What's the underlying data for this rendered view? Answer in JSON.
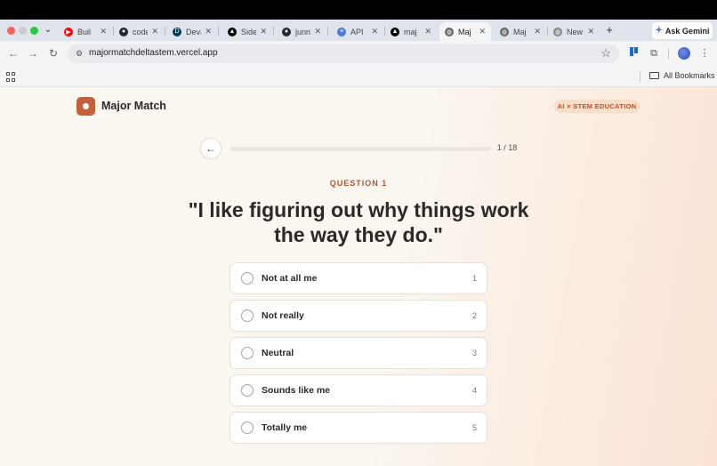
{
  "browser": {
    "tabs": [
      {
        "title": "Buil",
        "favicon": "youtube-icon",
        "color": "#ff0000",
        "glyph": "▶",
        "active": false
      },
      {
        "title": "code",
        "favicon": "github-icon",
        "color": "#24292f",
        "glyph": "●",
        "active": false
      },
      {
        "title": "Deva",
        "favicon": "devpost-icon",
        "color": "#003e54",
        "glyph": "D",
        "active": false
      },
      {
        "title": "Side",
        "favicon": "vercel-icon",
        "color": "#000000",
        "glyph": "▲",
        "active": false
      },
      {
        "title": "junn",
        "favicon": "github-icon",
        "color": "#24292f",
        "glyph": "●",
        "active": false
      },
      {
        "title": "API",
        "favicon": "api-icon",
        "color": "#4a7bd8",
        "glyph": "≡",
        "active": false
      },
      {
        "title": "maj",
        "favicon": "vercel-icon",
        "color": "#000000",
        "glyph": "▲",
        "active": false
      },
      {
        "title": "Maj",
        "favicon": "globe-icon",
        "color": "#666666",
        "glyph": "◍",
        "active": true
      },
      {
        "title": "Maj",
        "favicon": "globe-icon",
        "color": "#666666",
        "glyph": "◍",
        "active": false
      },
      {
        "title": "New",
        "favicon": "chrome-icon",
        "color": "#888888",
        "glyph": "◍",
        "active": false
      }
    ],
    "tab_close_glyph": "✕",
    "new_tab_glyph": "+",
    "ask_gemini": "Ask Gemini",
    "url": "majormatchdeltastem.vercel.app",
    "all_bookmarks": "All Bookmarks"
  },
  "app": {
    "brand": "Major Match",
    "badge": "AI × STEM EDUCATION",
    "accent_color": "#c4603a",
    "progress": {
      "current": 1,
      "total": 18,
      "label": "1 / 18"
    },
    "question_label": "QUESTION 1",
    "question_text": "\"I like figuring out why things work the way they do.\"",
    "options": [
      {
        "label": "Not at all me",
        "number": "1"
      },
      {
        "label": "Not really",
        "number": "2"
      },
      {
        "label": "Neutral",
        "number": "3"
      },
      {
        "label": "Sounds like me",
        "number": "4"
      },
      {
        "label": "Totally me",
        "number": "5"
      }
    ]
  }
}
